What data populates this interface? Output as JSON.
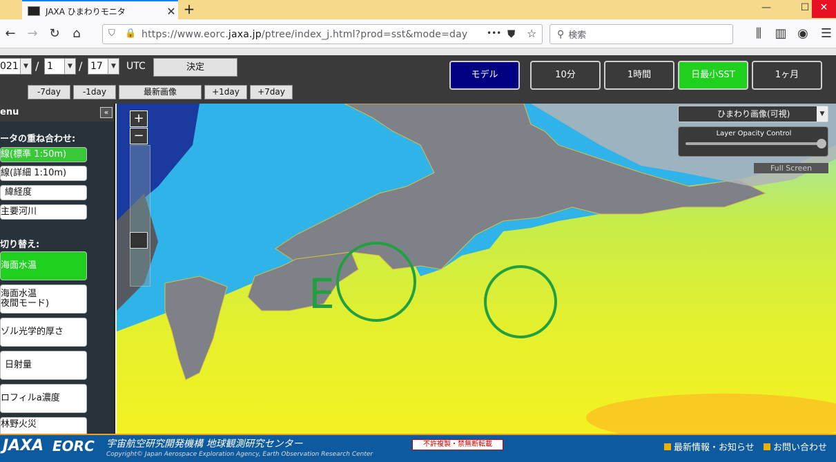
{
  "browser": {
    "tab_title": "JAXA ひまわりモニタ",
    "new_tab": "+",
    "url_prefix": "https://www.eorc.",
    "url_domain": "jaxa.jp",
    "url_path": "/ptree/index_j.html?prod=sst&mode=day",
    "search_placeholder": "検索",
    "more": "•••"
  },
  "header": {
    "year": "021",
    "month": "1",
    "day": "17",
    "slash": "/",
    "timezone": "UTC",
    "decide": "決定",
    "day_buttons": [
      "-7day",
      "-1day",
      "最新画像",
      "+1day",
      "+7day"
    ],
    "mode_buttons": [
      "モデル",
      "10分",
      "1時間",
      "日最小SST",
      "1ヶ月"
    ]
  },
  "sidebar": {
    "title": "enu",
    "overlay_title": "ータの重ね合わせ:",
    "overlay_items": [
      "線(標準 1:50m)",
      "線(詳細 1:10m)",
      "緯経度",
      "主要河川"
    ],
    "switch_title": "切り替え:",
    "product_items": [
      "海面水温",
      "海面水温\n夜間モード)",
      "ゾル光学的厚さ",
      "日射量",
      "ロフィルa濃度",
      "林野火災"
    ]
  },
  "map": {
    "zoom_in": "+",
    "zoom_out": "−",
    "layer_select": "ひまわり画像(可視)",
    "opacity_label": "Layer Opacity Control",
    "opacity_value": 1.0,
    "fullscreen": "Full Screen",
    "annotation_letter": "E"
  },
  "footer": {
    "jaxa": "JAXA",
    "eorc": "EORC",
    "org": "宇宙航空研究開発機構 地球観測研究センター",
    "copyright": "Copyright© Japan Aerospace Exploration Agency, Earth Observation Research Center",
    "notice": "不許複製・禁無断転載",
    "news": "最新情報・お知らせ",
    "contact": "お問い合わせ"
  },
  "colors": {
    "accent_green": "#1fd01f",
    "model_blue": "#000080",
    "footer_blue": "#0e5a9e"
  }
}
